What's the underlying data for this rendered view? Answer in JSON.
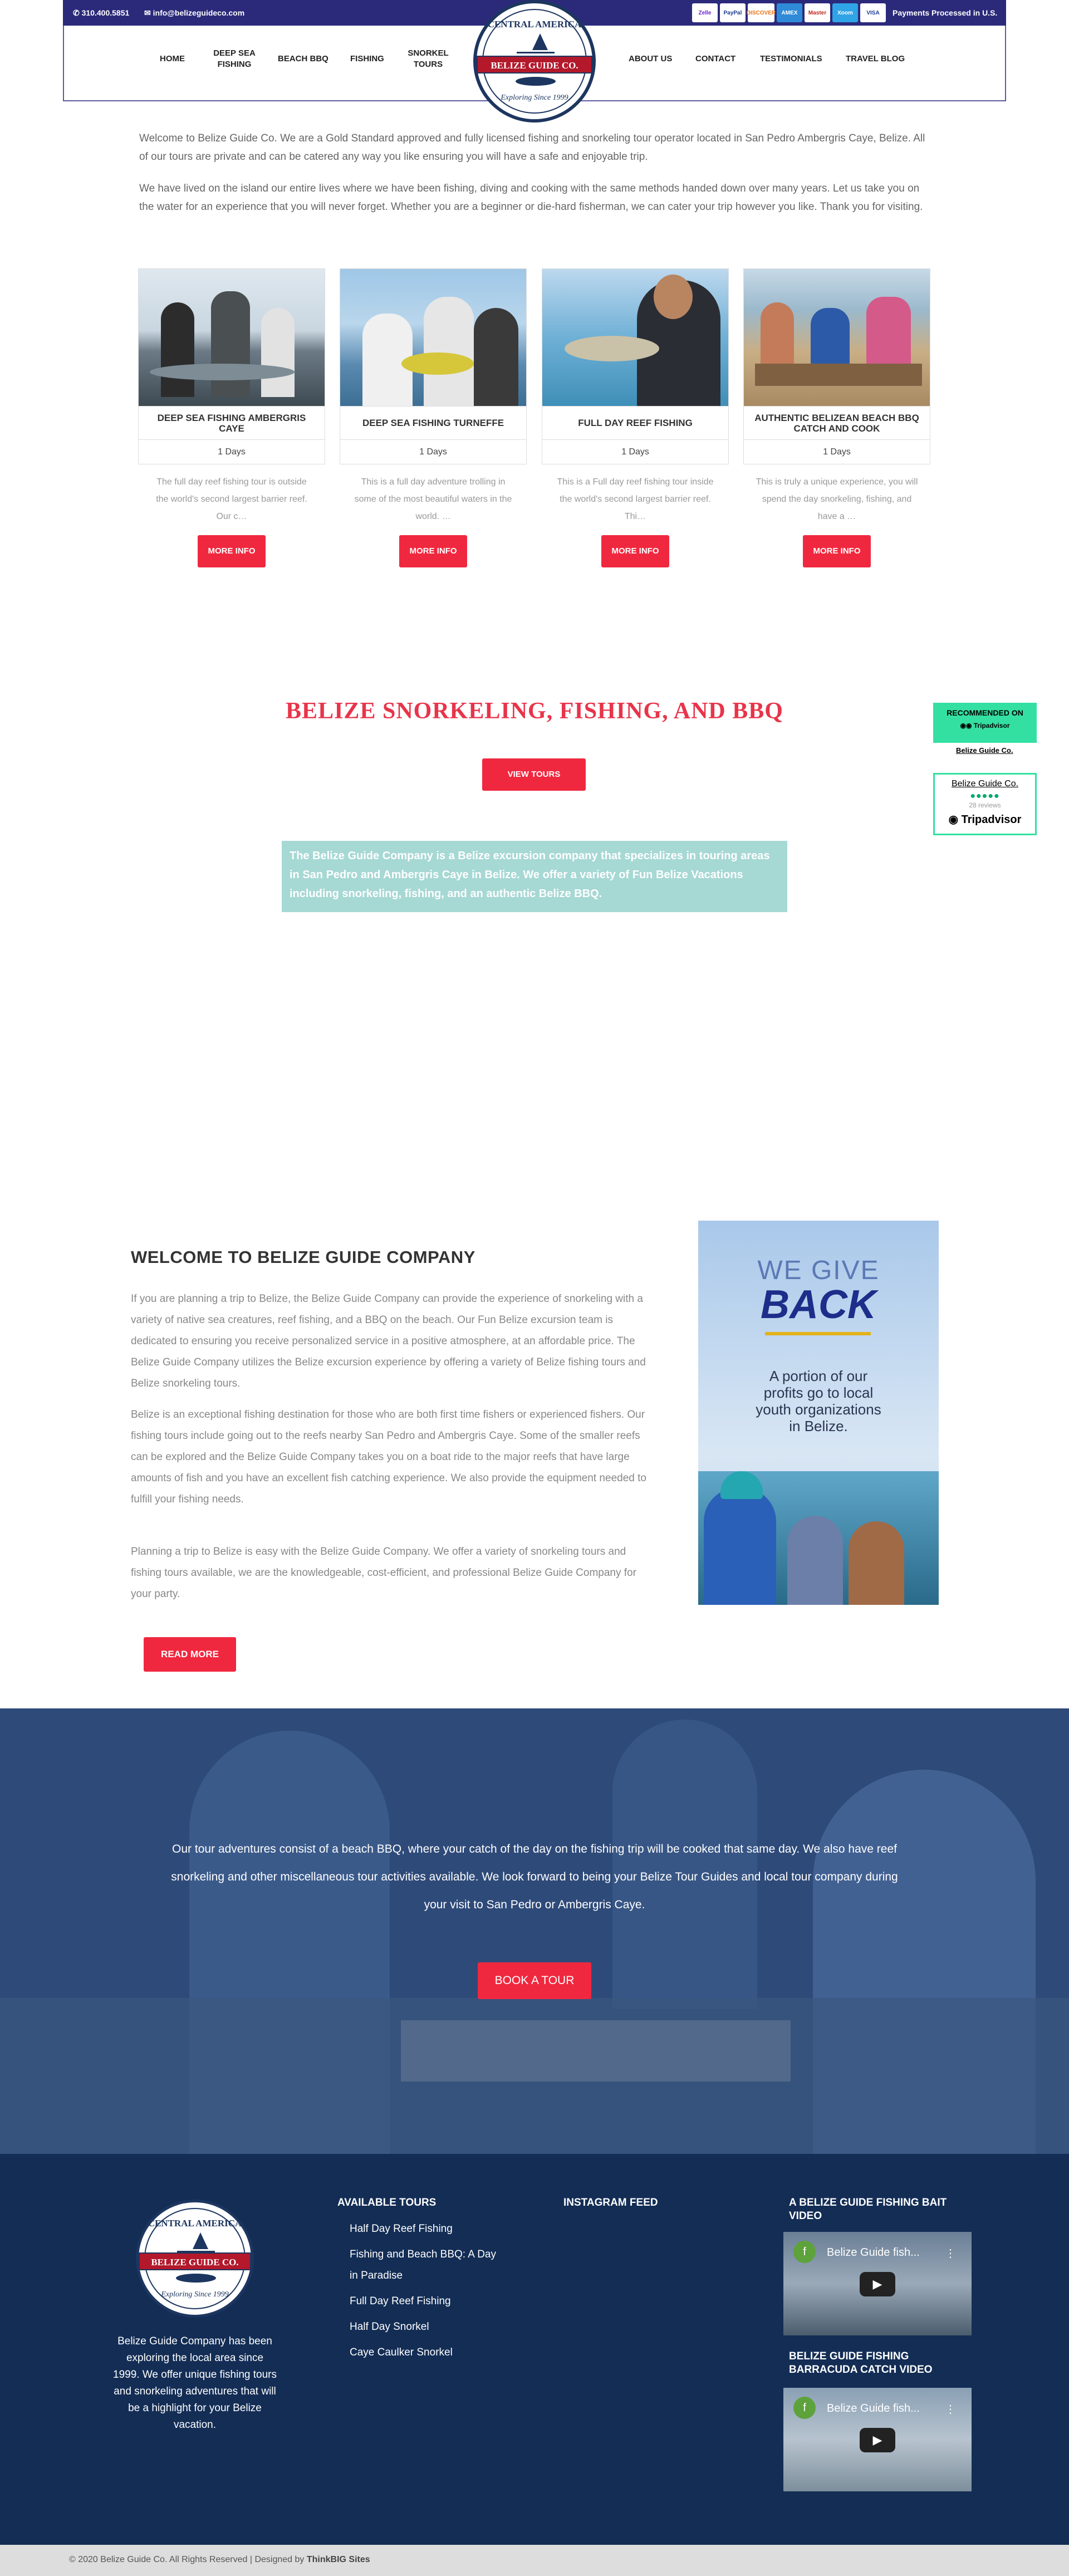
{
  "topbar": {
    "phone": "310.400.5851",
    "email": "info@belizeguideco.com",
    "payments": [
      "Zelle",
      "PayPal",
      "DISCOVER",
      "AMEX",
      "Master",
      "Xoom",
      "VISA"
    ],
    "processed": "Payments Processed in U.S."
  },
  "nav": {
    "home": "HOME",
    "deep_sea": "DEEP SEA FISHING",
    "beach_bbq": "BEACH BBQ",
    "fishing": "FISHING",
    "snorkel": "SNORKEL TOURS",
    "about": "ABOUT US",
    "contact": "CONTACT",
    "testimonials": "TESTIMONIALS",
    "blog": "TRAVEL BLOG"
  },
  "logo": {
    "top": "CENTRAL AMERICA",
    "name": "BELIZE GUIDE CO.",
    "bottom": "Exploring Since 1999"
  },
  "intro": {
    "p1": "Welcome to Belize Guide Co. We are a Gold Standard approved and fully licensed fishing and snorkeling tour operator located in San Pedro Ambergris Caye, Belize. All of our tours are private and can be catered any way you like ensuring you will have a safe and enjoyable trip.",
    "p2": "We have lived on the island our entire lives where we have been fishing, diving and cooking with the same methods handed down over many years. Let us take you on the water for an experience that you will never forget. Whether you are a beginner or die-hard fisherman, we can cater your trip however you like. Thank you for visiting."
  },
  "tours": [
    {
      "title": "DEEP SEA FISHING AMBERGRIS CAYE",
      "days": "1 Days",
      "desc": "The full day reef fishing tour is outside the world's second largest barrier reef. Our c…",
      "button": "MORE INFO"
    },
    {
      "title": "DEEP SEA FISHING TURNEFFE",
      "days": "1 Days",
      "desc": "This is a full day adventure trolling in some of the most beautiful waters in the world. …",
      "button": "MORE INFO"
    },
    {
      "title": "FULL DAY REEF FISHING",
      "days": "1 Days",
      "desc": "This is a Full day reef fishing tour inside the world's second largest barrier reef. Thi…",
      "button": "MORE INFO"
    },
    {
      "title": "AUTHENTIC BELIZEAN BEACH BBQ CATCH AND COOK",
      "days": "1 Days",
      "desc": "This is truly a unique experience, you will spend the day snorkeling, fishing, and have a …",
      "button": "MORE INFO"
    }
  ],
  "section2": {
    "heading": "BELIZE SNORKELING, FISHING, AND BBQ",
    "button": "VIEW TOURS",
    "teal": "The Belize Guide Company is a Belize excursion company that specializes in touring areas in San Pedro and Ambergris Caye in Belize. We offer a variety of Fun Belize Vacations including snorkeling, fishing, and an authentic Belize BBQ."
  },
  "tripadvisor": {
    "recommended": "RECOMMENDED ON",
    "brand": "Tripadvisor",
    "link": "Belize Guide Co.",
    "name": "Belize Guide Co.",
    "reviews": "28 reviews"
  },
  "welcome": {
    "heading": "WELCOME TO BELIZE GUIDE COMPANY",
    "p1": "If you are planning a trip to Belize, the Belize Guide Company can provide the experience of snorkeling with a variety of native sea creatures, reef fishing, and a BBQ on the beach. Our Fun Belize excursion team is dedicated to ensuring you receive personalized service in a positive atmosphere, at an affordable price. The Belize Guide Company utilizes the Belize excursion experience by offering a variety of Belize fishing tours and Belize snorkeling tours.",
    "p2": "Belize is an exceptional fishing destination for those who are both first time fishers or experienced fishers. Our fishing tours include going out to the reefs nearby San Pedro and Ambergris Caye. Some of the smaller reefs can be explored and the Belize Guide Company takes you on a boat ride to the major reefs that have large amounts of fish and you have an excellent fish catching experience. We also provide the equipment needed to fulfill your fishing needs.",
    "p3": "Planning a trip to Belize is easy with the Belize Guide Company. We offer a variety of snorkeling tours and fishing tours available, we are the knowledgeable, cost-efficient, and professional Belize Guide Company for your party.",
    "button": "READ MORE"
  },
  "giveback": {
    "line1": "WE GIVE",
    "line2": "BACK",
    "text": "A portion of our profits go to local youth organizations in Belize."
  },
  "hero": {
    "text": "Our tour adventures consist of a beach BBQ, where your catch of the day on the fishing trip will be cooked that same day. We also have reef snorkeling and other miscellaneous tour activities available. We look forward to being your Belize Tour Guides and local tour company during your visit to San Pedro or Ambergris Caye.",
    "button": "BOOK A TOUR"
  },
  "footer": {
    "about": "Belize Guide Company has been exploring the local area since 1999. We offer unique fishing tours and snorkeling adventures that will be a highlight for your Belize vacation.",
    "tours_heading": "AVAILABLE TOURS",
    "tours": [
      "Half Day Reef Fishing",
      "Fishing and Beach BBQ: A Day in Paradise",
      "Full Day Reef Fishing",
      "Half Day Snorkel",
      "Caye Caulker Snorkel"
    ],
    "instagram": "INSTAGRAM FEED",
    "video1_heading": "A BELIZE GUIDE FISHING BAIT VIDEO",
    "video1_title": "Belize Guide fish...",
    "video2_heading": "BELIZE GUIDE FISHING BARRACUDA CATCH VIDEO",
    "video2_title": "Belize Guide fish..."
  },
  "copyright": {
    "text": "© 2020 Belize Guide Co. All Rights Reserved | Designed by ",
    "designer": "ThinkBIG Sites"
  },
  "colors": {
    "navy": "#2b2a7a",
    "accent": "#f0283f",
    "teal": "#a6d8d4",
    "footer": "#132d55",
    "tripadvisor": "#34e0a1"
  }
}
